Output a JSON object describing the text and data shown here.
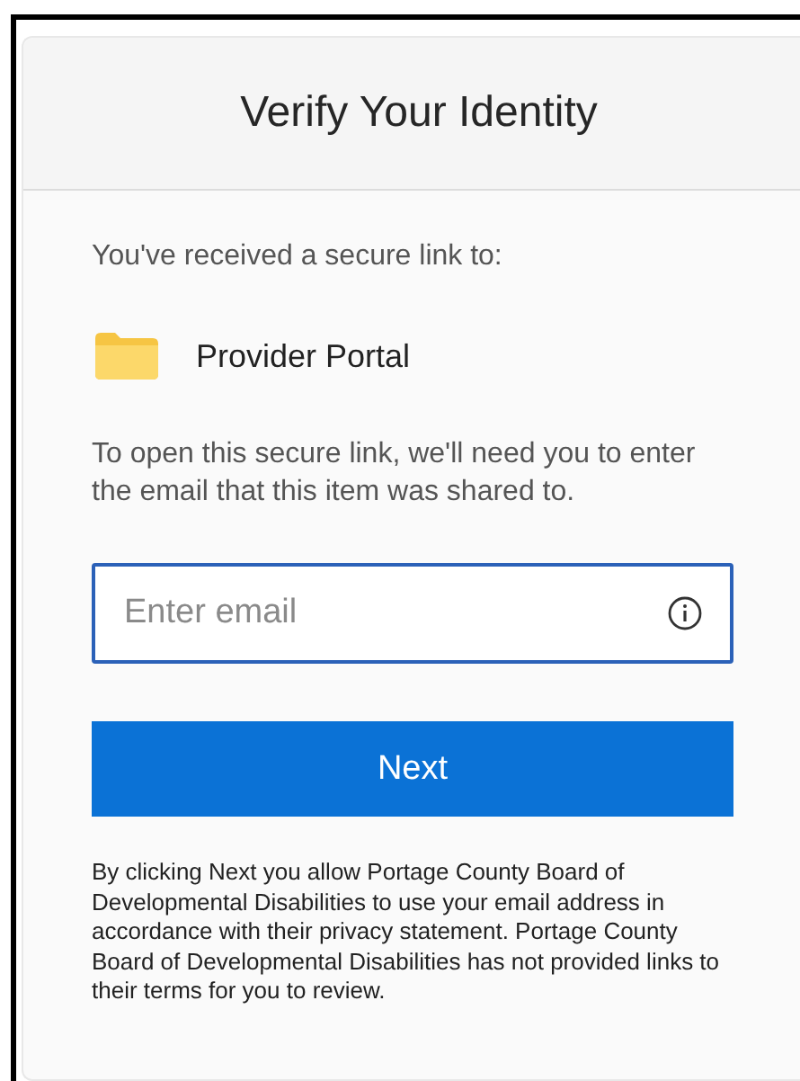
{
  "dialog": {
    "title": "Verify Your Identity"
  },
  "intro": "You've received a secure link to:",
  "item": {
    "name": "Provider Portal"
  },
  "instructions": "To open this secure link, we'll need you to enter the email that this item was shared to.",
  "email_field": {
    "placeholder": "Enter email",
    "focused": true
  },
  "next_button": "Next",
  "disclaimer": "By clicking Next you allow Portage County Board of Developmental Disabilities to use your email address in accordance with their privacy statement. Portage County Board of Developmental Disabilities has not provided links to their terms for you to review."
}
